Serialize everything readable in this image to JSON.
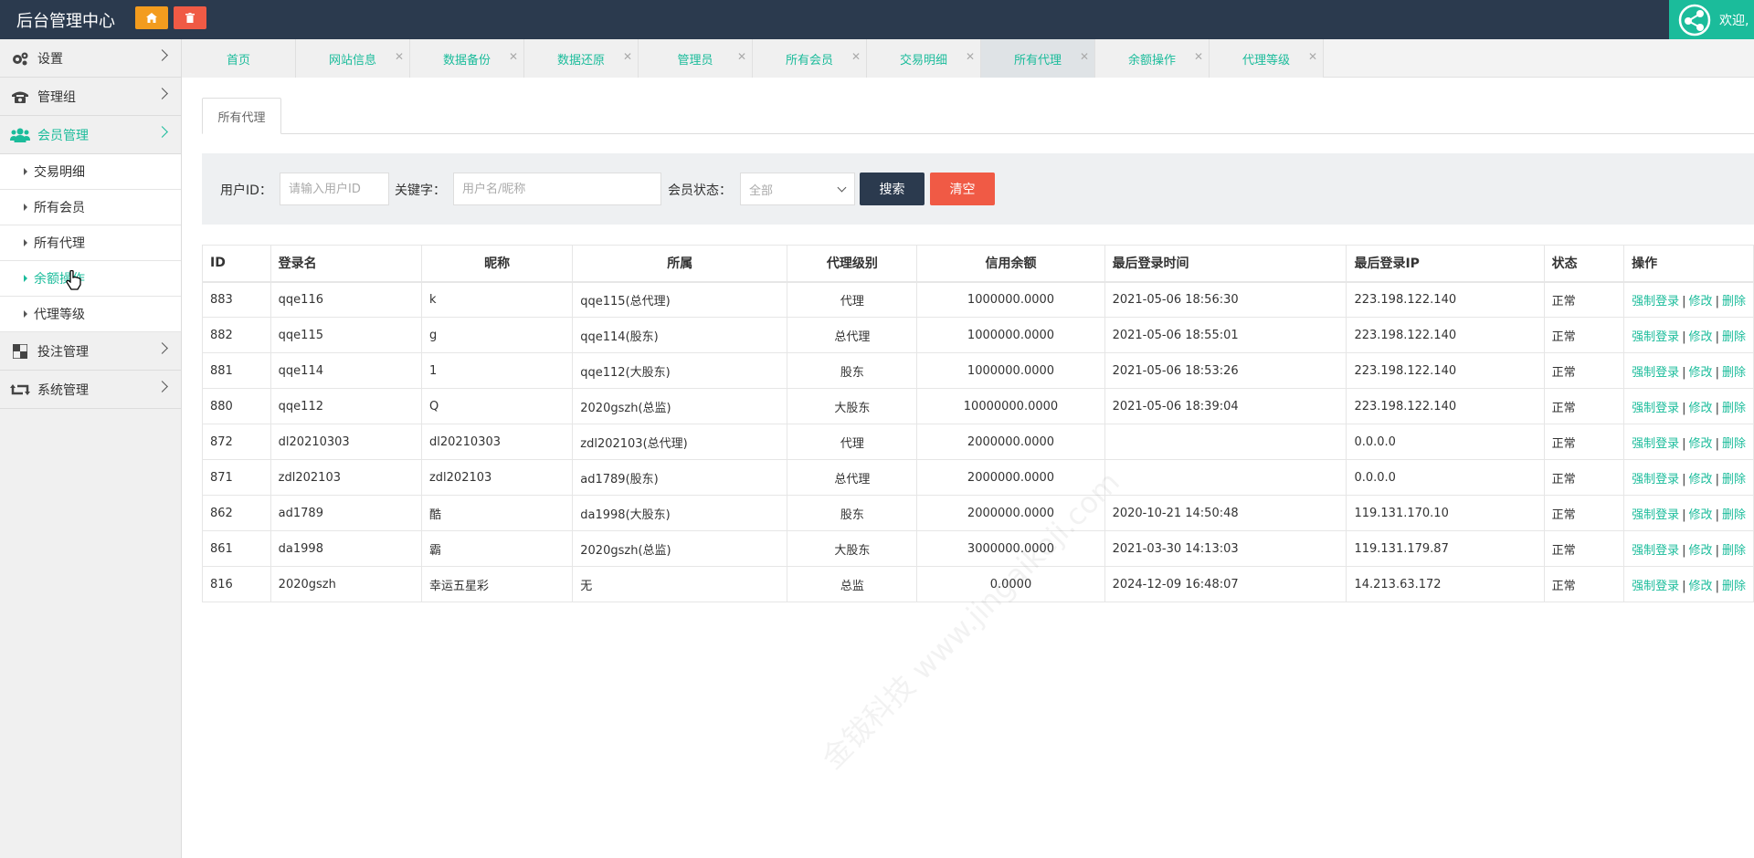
{
  "header": {
    "brand": "后台管理中心",
    "user": "欢迎,"
  },
  "sidebar": {
    "sections": [
      {
        "label": "设置"
      },
      {
        "label": "管理组"
      },
      {
        "label": "会员管理"
      }
    ],
    "member_items": [
      "交易明细",
      "所有会员",
      "所有代理",
      "余额操作",
      "代理等级"
    ],
    "bottom_sections": [
      {
        "label": "投注管理"
      },
      {
        "label": "系统管理"
      }
    ]
  },
  "tabs": [
    "首页",
    "网站信息",
    "数据备份",
    "数据还原",
    "管理员",
    "所有会员",
    "交易明细",
    "所有代理",
    "余额操作",
    "代理等级"
  ],
  "active_tab": "所有代理",
  "page": {
    "tab_title": "所有代理",
    "search": {
      "userid_label": "用户ID：",
      "userid_placeholder": "请输入用户ID",
      "keyword_label": "关键字：",
      "keyword_placeholder": "用户名/昵称",
      "status_label": "会员状态：",
      "status_value": "全部",
      "search_btn": "搜索",
      "clear_btn": "清空"
    },
    "table": {
      "headers": [
        "ID",
        "登录名",
        "昵称",
        "所属",
        "代理级别",
        "信用余额",
        "最后登录时间",
        "最后登录IP",
        "状态",
        "操作"
      ],
      "ops": [
        "强制登录",
        "修改",
        "删除"
      ],
      "rows": [
        [
          "883",
          "qqe116",
          "k",
          "qqe115(总代理)",
          "代理",
          "1000000.0000",
          "2021-05-06 18:56:30",
          "223.198.122.140",
          "正常"
        ],
        [
          "882",
          "qqe115",
          "g",
          "qqe114(股东)",
          "总代理",
          "1000000.0000",
          "2021-05-06 18:55:01",
          "223.198.122.140",
          "正常"
        ],
        [
          "881",
          "qqe114",
          "1",
          "qqe112(大股东)",
          "股东",
          "1000000.0000",
          "2021-05-06 18:53:26",
          "223.198.122.140",
          "正常"
        ],
        [
          "880",
          "qqe112",
          "Q",
          "2020gszh(总监)",
          "大股东",
          "10000000.0000",
          "2021-05-06 18:39:04",
          "223.198.122.140",
          "正常"
        ],
        [
          "872",
          "dl20210303",
          "dl20210303",
          "zdl202103(总代理)",
          "代理",
          "2000000.0000",
          "",
          "0.0.0.0",
          "正常"
        ],
        [
          "871",
          "zdl202103",
          "zdl202103",
          "ad1789(股东)",
          "总代理",
          "2000000.0000",
          "",
          "0.0.0.0",
          "正常"
        ],
        [
          "862",
          "ad1789",
          "酷",
          "da1998(大股东)",
          "股东",
          "2000000.0000",
          "2020-10-21 14:50:48",
          "119.131.170.10",
          "正常"
        ],
        [
          "861",
          "da1998",
          "霸",
          "2020gszh(总监)",
          "大股东",
          "3000000.0000",
          "2021-03-30 14:13:03",
          "119.131.179.87",
          "正常"
        ],
        [
          "816",
          "2020gszh",
          "幸运五星彩",
          "无",
          "总监",
          "0.0000",
          "2024-12-09 16:48:07",
          "14.213.63.172",
          "正常"
        ]
      ]
    }
  },
  "colors": {
    "accent": "#1bbc9b",
    "header": "#2b3a4e",
    "orange": "#f39c1e",
    "red": "#f05a45"
  },
  "watermark": "金钹科技 www.jingaikeji.com"
}
